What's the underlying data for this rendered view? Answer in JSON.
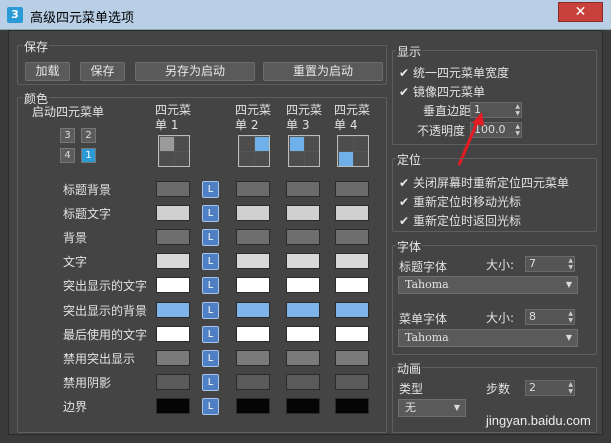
{
  "window": {
    "title": "高级四元菜单选项",
    "app_icon": "3",
    "close_glyph": "✕"
  },
  "save": {
    "group": "保存",
    "buttons": [
      "加载",
      "保存",
      "另存为启动",
      "重置为启动"
    ]
  },
  "colors": {
    "group": "颜色",
    "startup_label": "启动四元菜单",
    "quad_numbers": [
      "3",
      "2",
      "4",
      "1"
    ],
    "columns": [
      "四元菜单 1",
      "四元菜单 2",
      "四元菜单 3",
      "四元菜单 4"
    ],
    "column_lines": [
      [
        "四元菜",
        "单 1"
      ],
      [
        "四元菜",
        "单 2"
      ],
      [
        "四元菜",
        "单 3"
      ],
      [
        "四元菜",
        "单 4"
      ]
    ],
    "l_label": "L",
    "rows": [
      {
        "label": "标题背景",
        "color": "#6b6b6b"
      },
      {
        "label": "标题文字",
        "color": "#d0d0d0"
      },
      {
        "label": "背景",
        "color": "#6e6e6e"
      },
      {
        "label": "文字",
        "color": "#d8d8d8"
      },
      {
        "label": "突出显示的文字",
        "color": "#ffffff"
      },
      {
        "label": "突出显示的背景",
        "color": "#7fb4ea"
      },
      {
        "label": "最后使用的文字",
        "color": "#ffffff"
      },
      {
        "label": "禁用突出显示",
        "color": "#7a7a7a"
      },
      {
        "label": "禁用阴影",
        "color": "#5a5a5a"
      },
      {
        "label": "边界",
        "color": "#050505"
      }
    ]
  },
  "display": {
    "group": "显示",
    "uniform_width": "统一四元菜单宽度",
    "mirror": "镜像四元菜单",
    "vertical_margin_label": "垂直边距",
    "vertical_margin_value": "1",
    "opacity_label": "不透明度",
    "opacity_value": "100.0"
  },
  "position": {
    "group": "定位",
    "options": [
      "关闭屏幕时重新定位四元菜单",
      "重新定位时移动光标",
      "重新定位时返回光标"
    ]
  },
  "fonts": {
    "group": "字体",
    "title_font_label": "标题字体",
    "size_label": "大小:",
    "title_size": "7",
    "title_font": "Tahoma",
    "menu_font_label": "菜单字体",
    "menu_size": "8",
    "menu_font": "Tahoma"
  },
  "animation": {
    "group": "动画",
    "type_label": "类型",
    "type_value": "无",
    "steps_label": "步数",
    "steps_value": "2"
  },
  "watermark": "jingyan.baidu.com",
  "accent_color": "#e41b23"
}
